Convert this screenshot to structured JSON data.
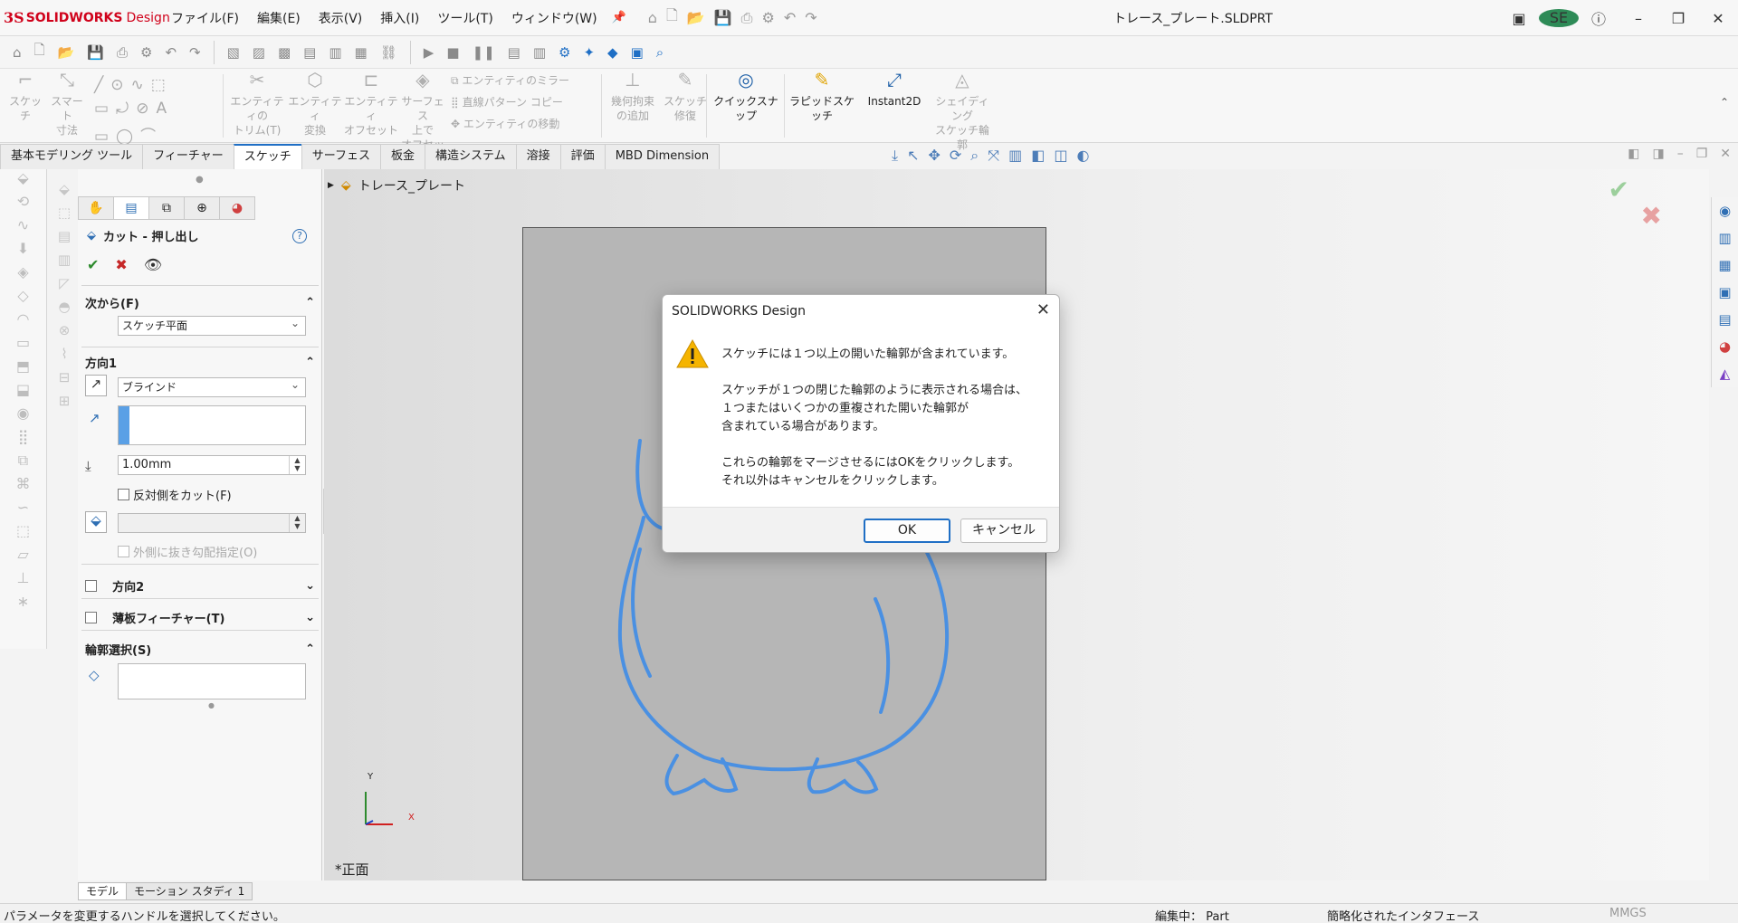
{
  "app": {
    "logo_ds": "3S",
    "logo_brand": "SOLIDWORKS",
    "logo_product": "Design",
    "menus": [
      "ファイル(F)",
      "編集(E)",
      "表示(V)",
      "挿入(I)",
      "ツール(T)",
      "ウィンドウ(W)"
    ],
    "document_title": "トレース_プレート.SLDPRT",
    "avatar_initials": "SE"
  },
  "command_manager": {
    "sketch": "スケッチ",
    "smart_dim_1": "スマート",
    "smart_dim_2": "寸法",
    "trim_1": "エンティティの",
    "trim_2": "トリム(T)",
    "convert_1": "エンティティ",
    "convert_2": "変換",
    "offset_1": "エンティティ",
    "offset_2": "オフセット",
    "surface_offset_1": "サーフェス",
    "surface_offset_2": "上で",
    "surface_offset_3": "オフセット",
    "mirror": "エンティティのミラー",
    "linear_pattern": "直線パターン コピー",
    "move": "エンティティの移動",
    "relations_1": "幾何拘束",
    "relations_2": "の追加",
    "repair_1": "スケッチ",
    "repair_2": "修復",
    "quick_snaps": "クイックスナップ",
    "rapid_sketch": "ラピッドスケッチ",
    "instant2d": "Instant2D",
    "shaded_1": "シェイディング",
    "shaded_2": "スケッチ輪",
    "shaded_3": "郭"
  },
  "tabs": [
    "基本モデリング ツール",
    "フィーチャー",
    "スケッチ",
    "サーフェス",
    "板金",
    "構造システム",
    "溶接",
    "評価",
    "MBD Dimension"
  ],
  "active_tab": "スケッチ",
  "property_manager": {
    "title": "カット - 押し出し",
    "help": "?",
    "from_label": "次から(F)",
    "from_value": "スケッチ平面",
    "dir1_label": "方向1",
    "end_condition": "ブラインド",
    "depth": "1.00mm",
    "flip_side": "反対側をカット(F)",
    "draft_outward": "外側に抜き勾配指定(O)",
    "dir2_label": "方向2",
    "thin_label": "薄板フィーチャー(T)",
    "contour_label": "輪郭選択(S)"
  },
  "graphics": {
    "tree_root": "トレース_プレート",
    "view_label": "*正面",
    "axis_y": "Y",
    "axis_x": "X"
  },
  "bottom_tabs": [
    "モデル",
    "モーション スタディ 1"
  ],
  "status_bar": {
    "hint": "パラメータを変更するハンドルを選択してください。",
    "editing": "編集中： Part",
    "interface": "簡略化されたインタフェース",
    "units": "MMGS"
  },
  "dialog": {
    "title": "SOLIDWORKS Design",
    "line1": "スケッチには１つ以上の開いた輪郭が含まれています。",
    "para2": "スケッチが１つの閉じた輪郭のように表示される場合は、\n１つまたはいくつかの重複された開いた輪郭が\n含まれている場合があります。",
    "para3": "これらの輪郭をマージさせるにはOKをクリックします。\nそれ以外はキャンセルをクリックします。",
    "ok": "OK",
    "cancel": "キャンセル"
  },
  "colors": {
    "accent": "#1f6fc5",
    "sketch": "#4a90e2",
    "brand": "#d0021b"
  }
}
